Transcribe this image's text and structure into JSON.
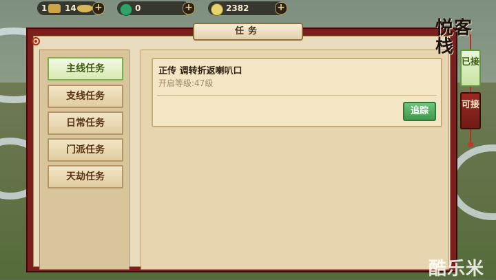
{
  "topbar": {
    "level_value": "1",
    "gold_value": "14",
    "jade_value": "0",
    "silver_value": "2382"
  },
  "panel": {
    "title": "任务"
  },
  "categories": [
    {
      "label": "主线任务",
      "active": true
    },
    {
      "label": "支线任务",
      "active": false
    },
    {
      "label": "日常任务",
      "active": false
    },
    {
      "label": "门派任务",
      "active": false
    },
    {
      "label": "天劫任务",
      "active": false
    }
  ],
  "quest": {
    "title": "正传  调转折返喇叭口",
    "requirement": "开启等级:47级",
    "track_label": "追踪"
  },
  "side_tabs": {
    "accepted_label": "已接",
    "available_label": "可接"
  },
  "logo_text": "悦客栈",
  "watermark": "酷乐米",
  "colors": {
    "active_green": "#79b04a",
    "track_button": "#3f9a4d",
    "panel_frame": "#7a1f1b"
  }
}
